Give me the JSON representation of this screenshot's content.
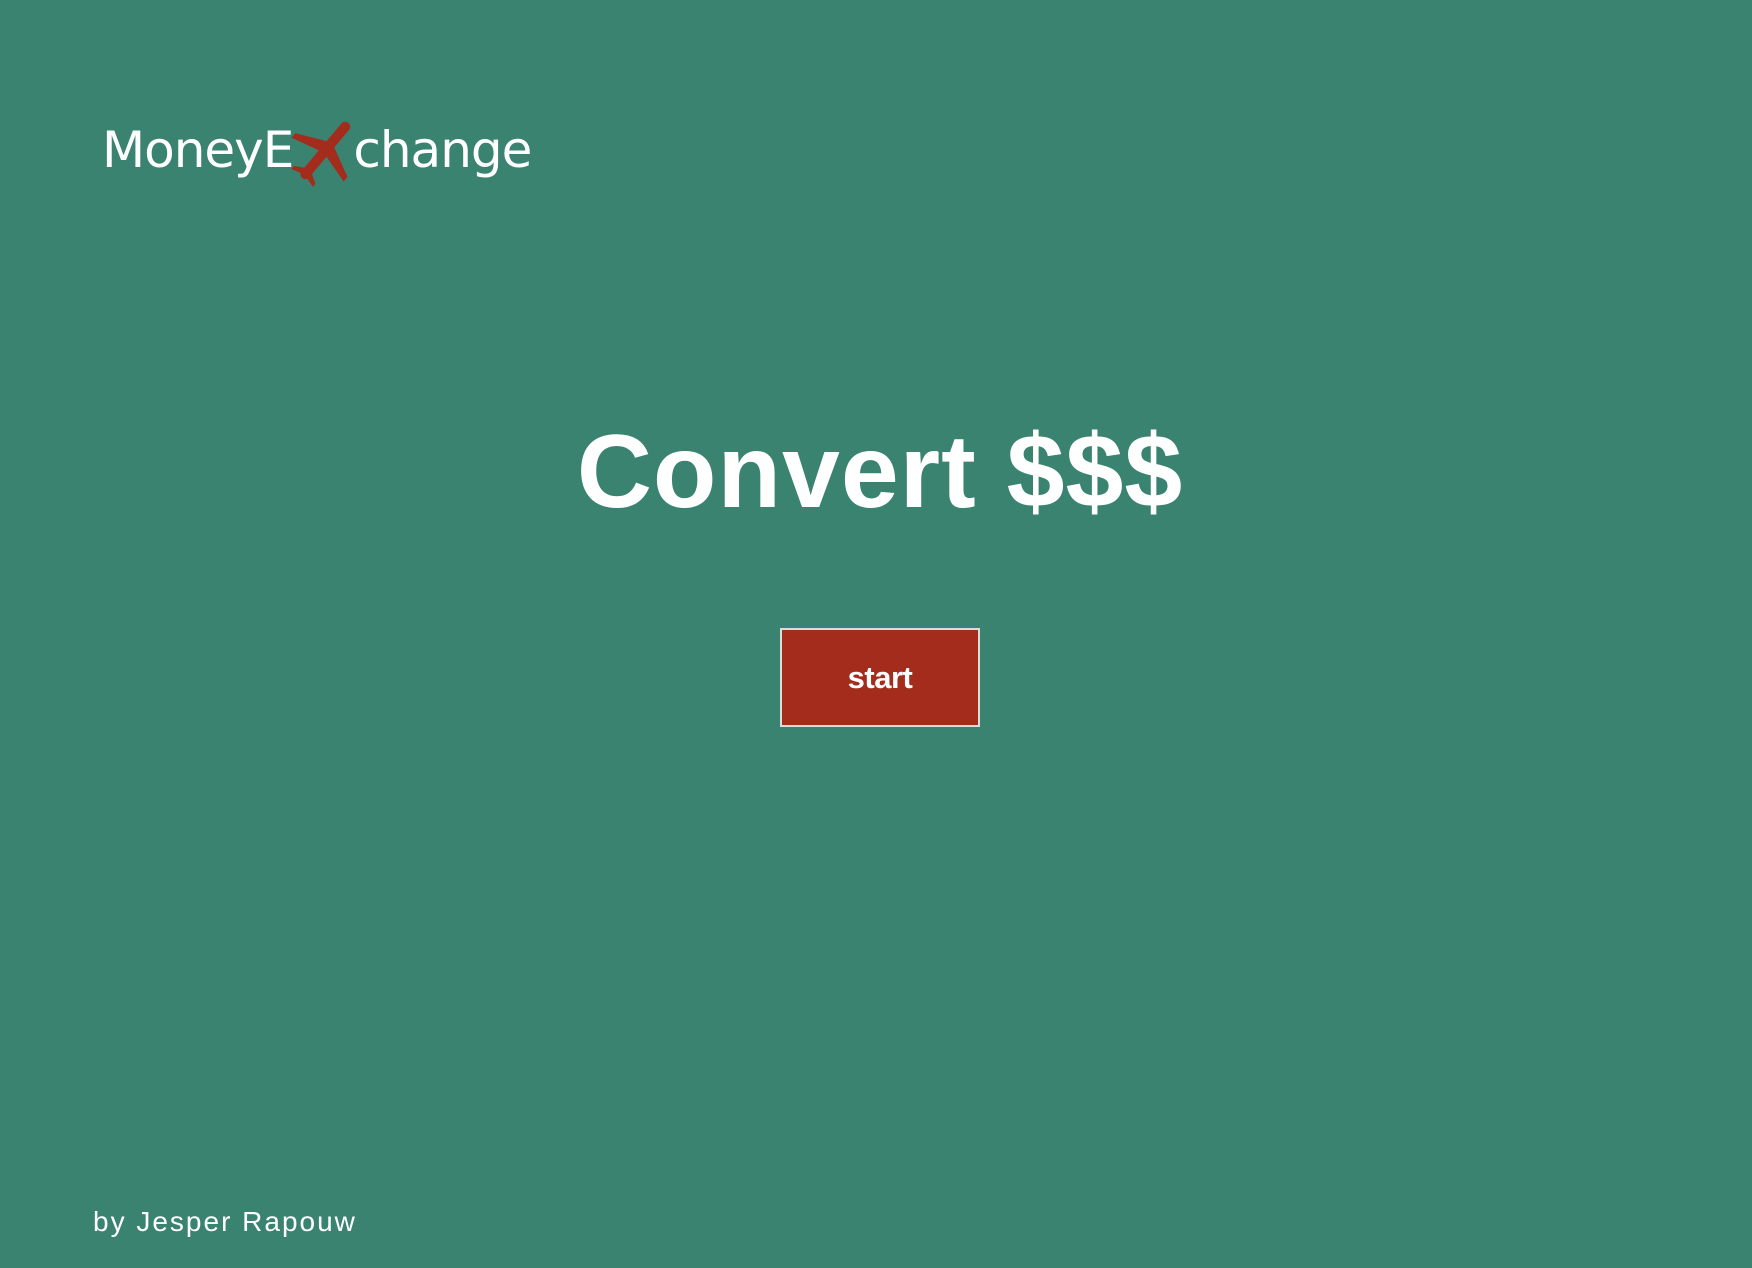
{
  "logo": {
    "text_before": "MoneyE",
    "plane_icon": "airplane-icon",
    "text_after": "change",
    "plane_color": "#a32c1c"
  },
  "hero": {
    "title": "Convert $$$"
  },
  "actions": {
    "start_label": "start",
    "start_color": "#a32c1c"
  },
  "footer": {
    "credit": "by Jesper Rapouw"
  },
  "theme": {
    "background": "#3a8370",
    "text": "#ffffff"
  }
}
